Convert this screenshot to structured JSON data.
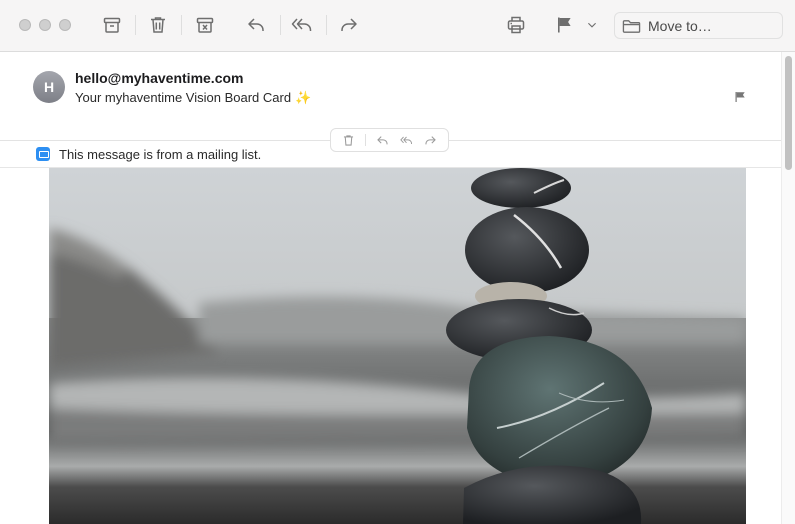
{
  "toolbar": {
    "move_to_label": "Move to…",
    "buttons": [
      "archive-icon",
      "trash-icon",
      "junk-icon",
      "reply-icon",
      "reply-all-icon",
      "forward-icon",
      "print-icon",
      "flag-icon",
      "chevron-down-icon",
      "folder-icon"
    ]
  },
  "message": {
    "avatar_initial": "H",
    "sender": "hello@myhaventime.com",
    "subject": "Your myhaventime Vision Board Card",
    "subject_emoji": "✨"
  },
  "banner": {
    "text": "This message is from a mailing list."
  },
  "colors": {
    "toolbar_bg": "#f6f5f5",
    "icon": "#6e6e6e",
    "banner_icon": "#2d8ff2"
  }
}
